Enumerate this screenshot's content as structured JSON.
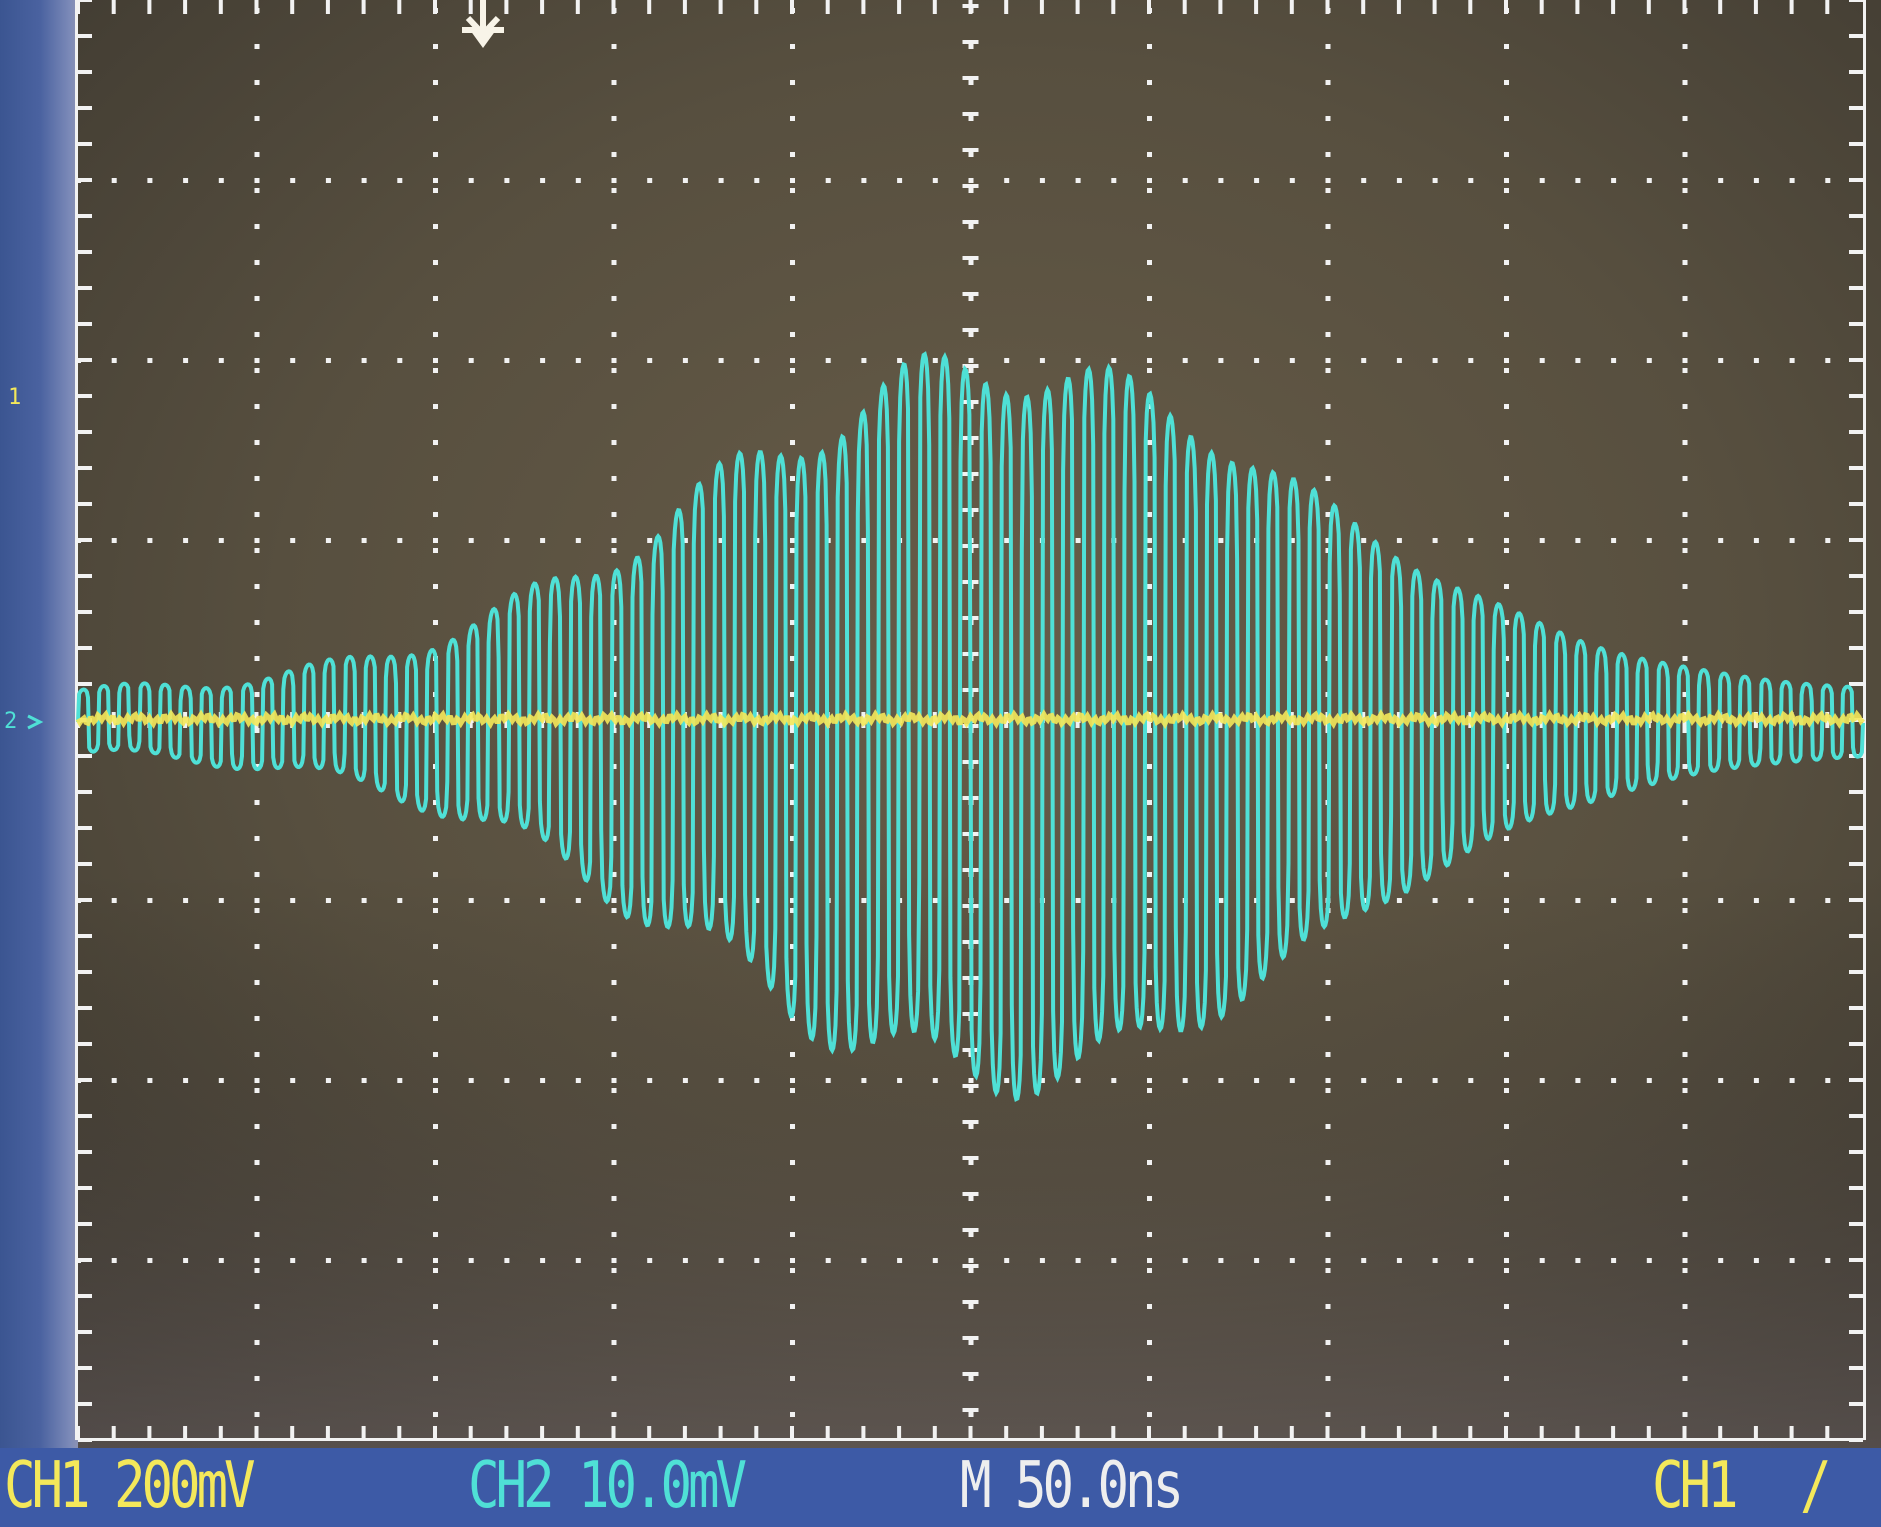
{
  "status_bar": {
    "ch1_label": "CH1",
    "ch1_scale": "200mV",
    "ch2_label": "CH2",
    "ch2_scale": "10.0mV",
    "timebase_label": "M",
    "timebase_value": "50.0ns",
    "trigger_source": "CH1",
    "trigger_slope_symbol": "/"
  },
  "markers": {
    "ch1_marker": "1",
    "ch2_marker": "2"
  },
  "icons": {
    "trigger_position": "trigger-position-arrow-icon",
    "ch1_ground": "ch1-ground-marker-icon",
    "ch2_ground": "ch2-ground-marker-icon"
  },
  "colors": {
    "ch1": "#f4e85a",
    "ch2": "#4fe0d6",
    "timebase": "#eeeeee",
    "status_bar": "#3d5aa6",
    "graticule": "#f2f2f2"
  },
  "display": {
    "h_divisions": 10,
    "v_divisions": 8,
    "ch2_envelope": "burst, max amplitude near center"
  }
}
